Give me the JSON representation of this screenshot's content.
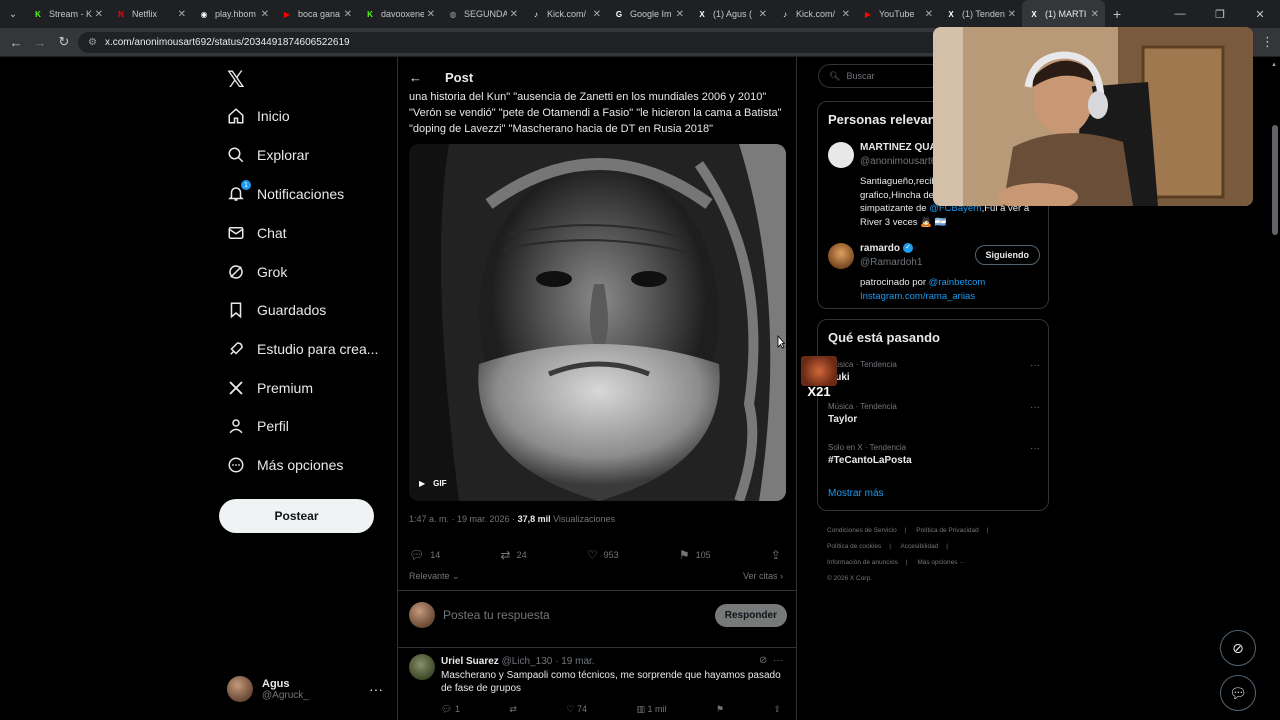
{
  "browser": {
    "tabs": [
      {
        "label": "Stream - K",
        "favicon_color": "#53fc18",
        "glyph": "K"
      },
      {
        "label": "Netflix",
        "favicon_color": "#e50914",
        "glyph": "N"
      },
      {
        "label": "play.hbom",
        "favicon_color": "#ffffff",
        "glyph": "◉"
      },
      {
        "label": "boca gana",
        "favicon_color": "#ff0000",
        "glyph": "▶"
      },
      {
        "label": "davooxene",
        "favicon_color": "#53fc18",
        "glyph": "K"
      },
      {
        "label": "SEGUNDA",
        "favicon_color": "#9aa0a6",
        "glyph": "◍"
      },
      {
        "label": "Kick.com/",
        "favicon_color": "#ffffff",
        "glyph": "♪"
      },
      {
        "label": "Google Im",
        "favicon_color": "#ffffff",
        "glyph": "G"
      },
      {
        "label": "(1) Agus (",
        "favicon_color": "#ffffff",
        "glyph": "X"
      },
      {
        "label": "Kick.com/",
        "favicon_color": "#ffffff",
        "glyph": "♪"
      },
      {
        "label": "YouTube",
        "favicon_color": "#ff0000",
        "glyph": "▶"
      },
      {
        "label": "(1) Tenden",
        "favicon_color": "#ffffff",
        "glyph": "X"
      },
      {
        "label": "(1) MARTI",
        "favicon_color": "#ffffff",
        "glyph": "X",
        "active": true
      }
    ],
    "url": "x.com/anonimousart692/status/2034491874606522619"
  },
  "nav": {
    "items": [
      {
        "label": "Inicio",
        "icon": "home-icon"
      },
      {
        "label": "Explorar",
        "icon": "search-icon"
      },
      {
        "label": "Notificaciones",
        "icon": "bell-icon",
        "badge": "1"
      },
      {
        "label": "Chat",
        "icon": "mail-icon"
      },
      {
        "label": "Grok",
        "icon": "grok-icon"
      },
      {
        "label": "Guardados",
        "icon": "bookmark-icon"
      },
      {
        "label": "Estudio para crea...",
        "icon": "rocket-icon"
      },
      {
        "label": "Premium",
        "icon": "x-icon"
      },
      {
        "label": "Perfil",
        "icon": "person-icon"
      },
      {
        "label": "Más opciones",
        "icon": "more-circle-icon"
      }
    ],
    "post_button": "Postear",
    "account": {
      "name": "Agus",
      "handle": "@Agruck_"
    }
  },
  "post": {
    "header_title": "Post",
    "text": "una historia del Kun\" \"ausencia de Zanetti en los mundiales 2006 y 2010\" \"Verón se vendió\" \"pete de Otamendi a Fasio\" \"le hicieron la cama a Batista\" \"doping de Lavezzi\" \"Mascherano hacia de DT en Rusia 2018\"",
    "media_tag": "GIF",
    "timestamp": "1:47 a. m. · 19 mar. 2026 · ",
    "views_count": "37,8 mil",
    "views_label": " Visualizaciones",
    "stats": {
      "replies": "14",
      "reposts": "24",
      "likes": "953",
      "bookmarks": "105"
    },
    "sort_label": "Relevante",
    "quotes_label": "Ver citas"
  },
  "reply_composer": {
    "placeholder": "Postea tu respuesta",
    "button": "Responder"
  },
  "reply": {
    "name": "Uriel Suarez",
    "meta": " @Lich_130 · 19 mar.",
    "text": "Mascherano y Sampaoli como técnicos, me sorprende que hayamos pasado de fase de grupos",
    "stats": {
      "replies": "1",
      "reposts": "",
      "likes": "74",
      "views": "1 mil"
    }
  },
  "right": {
    "search_placeholder": "Buscar",
    "relevant_title": "Personas relevantes",
    "people": [
      {
        "name": "MARTINEZ QUA",
        "handle": "@anonimousart6",
        "bio": "Santiagueño,recibido de diseño grafico,Hincha de Independiente y simpatizante de ",
        "bio_link": "@FCBayern",
        "bio_tail": ",Fui a ver a River 3 veces 🙇🏻 🇦🇷"
      },
      {
        "name": "ramardo",
        "handle": "@Ramardoh1",
        "button": "Siguiendo",
        "bio": "patrocinado por ",
        "bio_link": "@rainbetcom",
        "bio_link2": "Instagram.com/rama_ariias"
      }
    ],
    "trending_title": "Qué está pasando",
    "trends": [
      {
        "category": "Música · Tendencia",
        "name": "Duki"
      },
      {
        "category": "Música · Tendencia",
        "name": "Taylor"
      },
      {
        "category": "Solo en X · Tendencia",
        "name": "#TeCantoLaPosta"
      }
    ],
    "show_more": "Mostrar más",
    "footer": [
      "Condiciones de Servicio",
      "Política de Privacidad",
      "Política de cookies",
      "Accesibilidad",
      "Información de anuncios",
      "Más opciones ···",
      "© 2026 X Corp."
    ]
  },
  "overlay": {
    "sticker_text": "X21"
  }
}
